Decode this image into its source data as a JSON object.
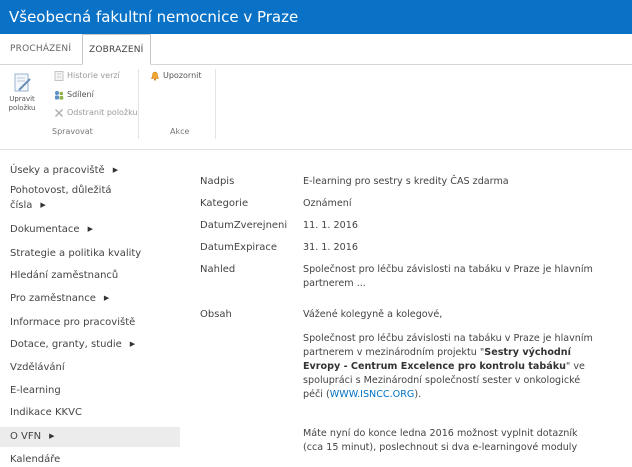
{
  "site": {
    "title": "Všeobecná fakultní nemocnice v Praze"
  },
  "ribbon": {
    "tabs": [
      "PROCHÁZENÍ",
      "ZOBRAZENÍ"
    ],
    "edit_item": "Upravit položku",
    "history": "Historie verzí",
    "share": "Sdílení",
    "delete": "Odstranit položku",
    "manage_group": "Spravovat",
    "alert": "Upozornit",
    "actions_group": "Akce"
  },
  "nav": {
    "items": [
      {
        "label": "Úseky a pracoviště",
        "arrow": "▶"
      },
      {
        "label": "Pohotovost, důležitá",
        "label2": "čísla",
        "arrow": "▶"
      },
      {
        "label": "Dokumentace",
        "arrow": "▶"
      },
      {
        "label": "Strategie a politika kvality"
      },
      {
        "label": "Hledání zaměstnanců"
      },
      {
        "label": "Pro zaměstnance",
        "arrow": "▶"
      },
      {
        "label": "Informace pro pracoviště"
      },
      {
        "label": "Dotace, granty, studie",
        "arrow": "▶"
      },
      {
        "label": "Vzdělávání"
      },
      {
        "label": "E-learning"
      },
      {
        "label": "Indikace KKVC"
      },
      {
        "label": "O VFN",
        "arrow": "▶"
      },
      {
        "label": "Kalendáře"
      }
    ]
  },
  "item": {
    "fields": {
      "nadpis_label": "Nadpis",
      "nadpis_value": "E-learning pro sestry s kredity ČAS zdarma",
      "kategorie_label": "Kategorie",
      "kategorie_value": "Oznámení",
      "datum_zverejneni_label": "DatumZverejneni",
      "datum_zverejneni_value": "11. 1. 2016",
      "datum_expirace_label": "DatumExpirace",
      "datum_expirace_value": "31. 1. 2016",
      "nahled_label": "Nahled",
      "nahled_value_1": "Společnost pro léčbu závislosti na tabáku v Praze je hlavním",
      "nahled_value_2": "partnerem ...",
      "obsah_label": "Obsah"
    },
    "obsah": {
      "greeting": "Vážené kolegyně a kolegové,",
      "p1_l1": "Společnost pro léčbu závislosti na tabáku v Praze je hlavním",
      "p1_l2a": "partnerem v mezinárodním projektu \"",
      "p1_l2b": "Sestry východní",
      "p1_l3a": "Evropy - Centrum Excelence pro kontrolu tabáku",
      "p1_l3b": "\" ve",
      "p1_l4": "spolupráci s Mezinárodní společností sester v onkologické",
      "p1_l5a": "péči (",
      "p1_link": "WWW.ISNCC.ORG",
      "p1_l5b": ").",
      "p2_l1": "Máte nyní do konce ledna 2016 možnost vyplnit dotazník",
      "p2_l2": "(cca 15 minut), poslechnout si dva e-learningové moduly"
    }
  }
}
